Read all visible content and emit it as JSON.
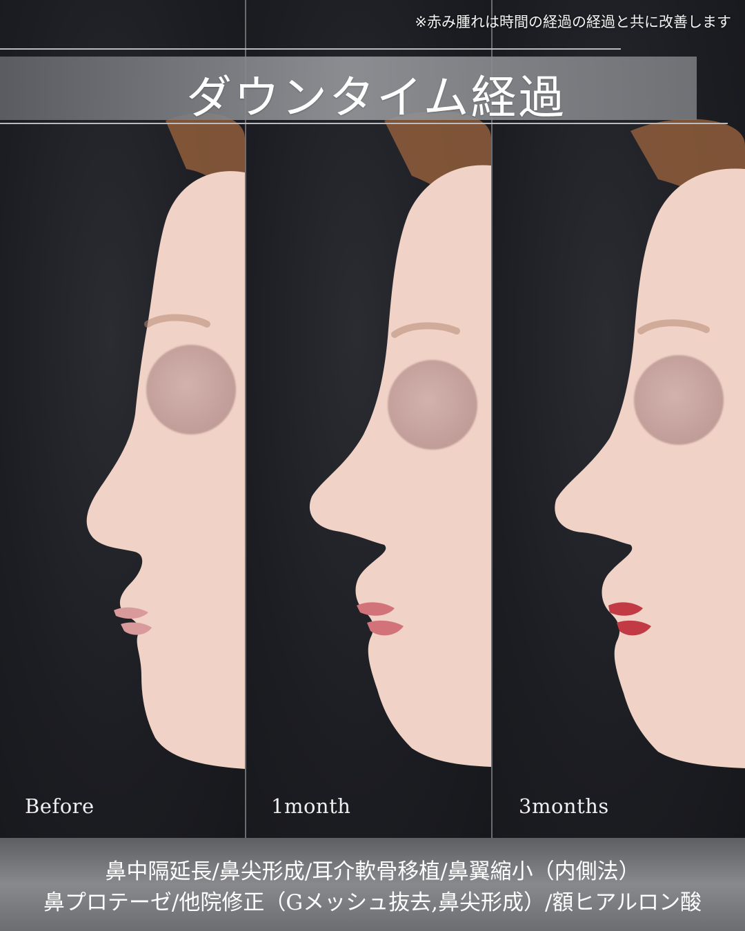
{
  "note": "※赤み腫れは時間の経過の経過と共に改善します",
  "title": "ダウンタイム経過",
  "panels": [
    {
      "label": "Before"
    },
    {
      "label": "1month"
    },
    {
      "label": "3months"
    }
  ],
  "procedures": [
    "鼻中隔延長/鼻尖形成/耳介軟骨移植/鼻翼縮小（内側法）",
    "鼻プロテーゼ/他院修正（Gメッシュ抜去,鼻尖形成）/額ヒアルロン酸"
  ],
  "colors": {
    "background": "#1c1d22",
    "skin": "#f0d2c6",
    "hair": "#8a5a3a",
    "lips_before": "#d99a9c",
    "lips_1month": "#d2737a",
    "lips_3months": "#c23a44",
    "banner": "#8f9195",
    "footer": "#7a7b7f"
  }
}
